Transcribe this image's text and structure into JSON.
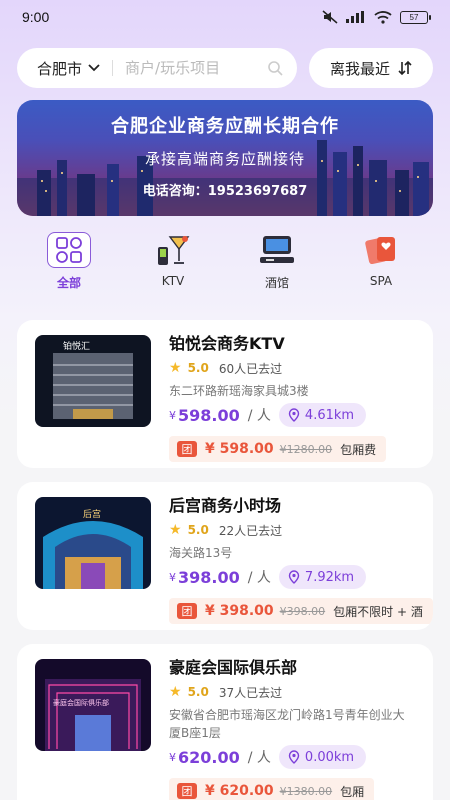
{
  "status": {
    "time": "9:00",
    "battery": "57"
  },
  "search": {
    "city": "合肥市",
    "placeholder": "商户/玩乐项目",
    "sort_label": "离我最近"
  },
  "banner": {
    "title": "合肥企业商务应酬长期合作",
    "subtitle": "承接高端商务应酬接待",
    "phone": "电话咨询：19523697687"
  },
  "categories": [
    {
      "label": "全部",
      "icon": "grid-icon"
    },
    {
      "label": "KTV",
      "icon": "cocktail-icon"
    },
    {
      "label": "酒馆",
      "icon": "bar-counter-icon"
    },
    {
      "label": "SPA",
      "icon": "cards-icon"
    }
  ],
  "venues": [
    {
      "name": "铂悦会商务KTV",
      "score": "5.0",
      "visits": "60人已去过",
      "address": "东二环路新瑶海家具城3楼",
      "yen": "¥",
      "price": "598.00",
      "per": "/ 人",
      "distance": "4.61km",
      "deal_tag": "团",
      "deal_price": "¥ 598.00",
      "old_price": "¥1280.00",
      "deal_desc": "包厢费",
      "sign_text": "铂悦汇"
    },
    {
      "name": "后宫商务小时场",
      "score": "5.0",
      "visits": "22人已去过",
      "address": "海关路13号",
      "yen": "¥",
      "price": "398.00",
      "per": "/ 人",
      "distance": "7.92km",
      "deal_tag": "团",
      "deal_price": "¥ 398.00",
      "old_price": "¥398.00",
      "deal_desc": "包厢不限时 + 酒",
      "sign_text": "后宫"
    },
    {
      "name": "豪庭会国际俱乐部",
      "score": "5.0",
      "visits": "37人已去过",
      "address": "安徽省合肥市瑶海区龙门岭路1号青年创业大厦B座1层",
      "yen": "¥",
      "price": "620.00",
      "per": "/ 人",
      "distance": "0.00km",
      "deal_tag": "团",
      "deal_price": "¥ 620.00",
      "old_price": "¥1380.00",
      "deal_desc": "包厢",
      "sign_text": "豪庭会国际俱乐部"
    }
  ],
  "colors": {
    "accent": "#7c3fd9",
    "deal": "#e9563b",
    "star": "#f5b92a"
  }
}
